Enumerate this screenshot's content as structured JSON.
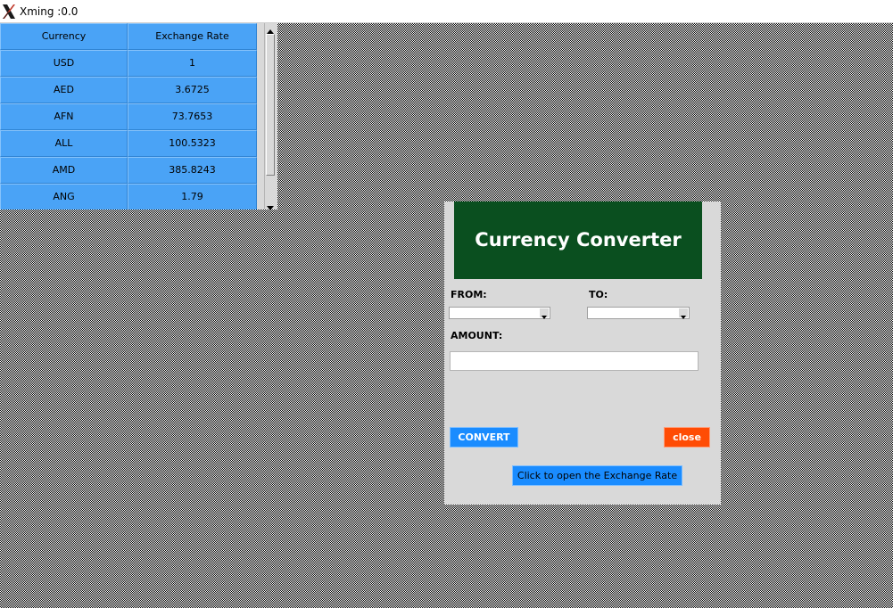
{
  "window": {
    "title": "Xming :0.0"
  },
  "rate_table": {
    "headers": [
      "Currency",
      "Exchange Rate"
    ],
    "rows": [
      {
        "currency": "USD",
        "rate": "1"
      },
      {
        "currency": "AED",
        "rate": "3.6725"
      },
      {
        "currency": "AFN",
        "rate": "73.7653"
      },
      {
        "currency": "ALL",
        "rate": "100.5323"
      },
      {
        "currency": "AMD",
        "rate": "385.8243"
      },
      {
        "currency": "ANG",
        "rate": "1.79"
      }
    ],
    "cell_color": "#4aa3f6"
  },
  "converter": {
    "title": "Currency Converter",
    "header_color": "#0a4f1f",
    "from_label": "FROM:",
    "from_value": "",
    "to_label": "TO:",
    "to_value": "",
    "amount_label": "AMOUNT:",
    "amount_value": "",
    "convert_label": "CONVERT",
    "convert_color": "#1a8cff",
    "close_label": "close",
    "close_color": "#ff4c05",
    "open_rates_label": "Click to open the Exchange Rate"
  },
  "icons": {
    "app_logo": "xming-x-logo-icon",
    "combo_arrow": "chevron-down-icon",
    "scroll_up": "arrow-up-icon",
    "scroll_down": "arrow-down-icon"
  }
}
